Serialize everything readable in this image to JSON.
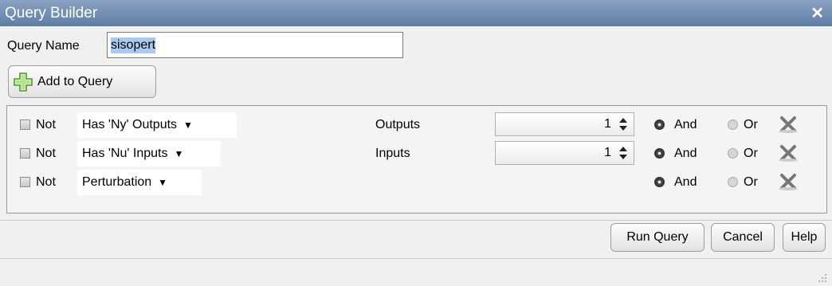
{
  "window": {
    "title": "Query Builder",
    "close_icon": "close-icon"
  },
  "query_name": {
    "label": "Query Name",
    "value": "sisopert"
  },
  "add_button": {
    "label": "Add to Query",
    "icon": "plus-icon"
  },
  "rows": [
    {
      "not_label": "Not",
      "not_checked": false,
      "condition": "Has 'Ny' Outputs",
      "field_label": "Outputs",
      "field_value": "1",
      "and_label": "And",
      "or_label": "Or",
      "selected": "And"
    },
    {
      "not_label": "Not",
      "not_checked": false,
      "condition": "Has 'Nu' Inputs",
      "field_label": "Inputs",
      "field_value": "1",
      "and_label": "And",
      "or_label": "Or",
      "selected": "And"
    },
    {
      "not_label": "Not",
      "not_checked": false,
      "condition": "Perturbation",
      "and_label": "And",
      "or_label": "Or",
      "selected": "And"
    }
  ],
  "buttons": {
    "run": "Run Query",
    "cancel": "Cancel",
    "help": "Help"
  }
}
